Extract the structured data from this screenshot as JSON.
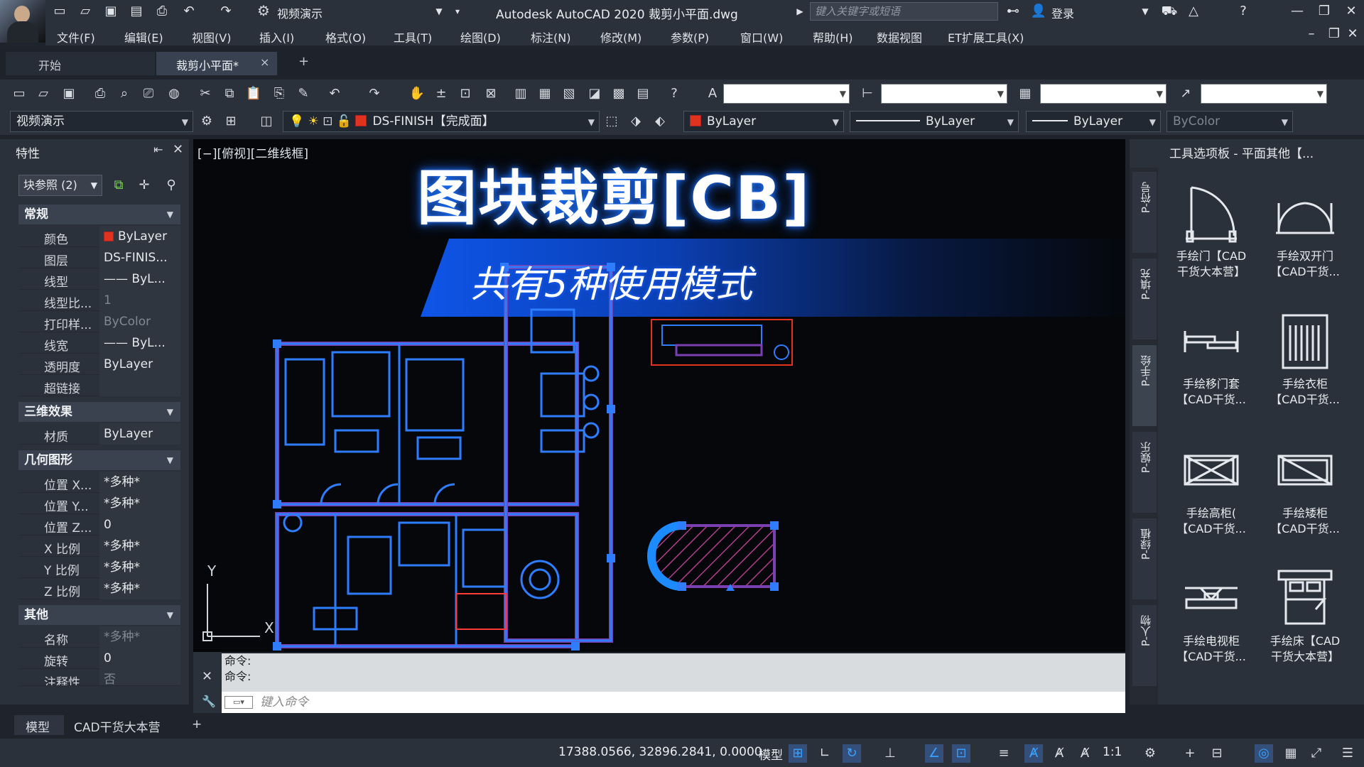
{
  "titlebar": {
    "workspace": "视频演示",
    "title": "Autodesk AutoCAD 2020    裁剪小平面.dwg",
    "search_placeholder": "键入关键字或短语",
    "login": "登录"
  },
  "menu": [
    "文件(F)",
    "编辑(E)",
    "视图(V)",
    "插入(I)",
    "格式(O)",
    "工具(T)",
    "绘图(D)",
    "标注(N)",
    "修改(M)",
    "参数(P)",
    "窗口(W)",
    "帮助(H)",
    "数据视图",
    "ET扩展工具(X)"
  ],
  "tabs": {
    "start": "开始",
    "file": "裁剪小平面*",
    "close": "×",
    "add": "+"
  },
  "toolbar2": {
    "workspace_combo": "视频演示",
    "layer_combo": "DS-FINISH【完成面】",
    "color_combo": "ByLayer",
    "linetype_combo": "ByLayer",
    "lineweight_combo": "ByLayer",
    "plotstyle_combo": "ByColor"
  },
  "properties": {
    "title": "特性",
    "selection": "块参照 (2)",
    "sections": {
      "general": "常规",
      "effects3d": "三维效果",
      "geometry": "几何图形",
      "misc": "其他"
    },
    "general": [
      {
        "k": "颜色",
        "v": "ByLayer"
      },
      {
        "k": "图层",
        "v": "DS-FINIS..."
      },
      {
        "k": "线型",
        "v": "—— ByL..."
      },
      {
        "k": "线型比...",
        "v": "1"
      },
      {
        "k": "打印样...",
        "v": "ByColor"
      },
      {
        "k": "线宽",
        "v": "—— ByL..."
      },
      {
        "k": "透明度",
        "v": "ByLayer"
      },
      {
        "k": "超链接",
        "v": ""
      }
    ],
    "effects3d": [
      {
        "k": "材质",
        "v": "ByLayer"
      }
    ],
    "geometry": [
      {
        "k": "位置 X...",
        "v": "*多种*"
      },
      {
        "k": "位置 Y...",
        "v": "*多种*"
      },
      {
        "k": "位置 Z...",
        "v": "0"
      },
      {
        "k": "X 比例",
        "v": "*多种*"
      },
      {
        "k": "Y 比例",
        "v": "*多种*"
      },
      {
        "k": "Z 比例",
        "v": "*多种*"
      }
    ],
    "misc": [
      {
        "k": "名称",
        "v": "*多种*"
      },
      {
        "k": "旋转",
        "v": "0"
      },
      {
        "k": "注释性",
        "v": "否"
      }
    ]
  },
  "viewport": {
    "label": "[−][俯视][二维线框]",
    "headline": "图块裁剪[CB]",
    "subline": "共有5种使用模式",
    "ucs_x": "X",
    "ucs_y": "Y"
  },
  "command": {
    "history": [
      "命令:",
      "命令:"
    ],
    "placeholder": "键入命令"
  },
  "palette": {
    "title": "工具选项板 - 平面其他【...",
    "vtabs": [
      "P-符号",
      "P-填充",
      "P-手绘",
      "P-娱乐",
      "P-绿植",
      "P-人物"
    ],
    "tools": [
      "手绘门【CAD\n干货大本营】",
      "手绘双开门\n【CAD干货...",
      "手绘移门套\n【CAD干货...",
      "手绘衣柜\n【CAD干货...",
      "手绘高柜(\n【CAD干货...",
      "手绘矮柜\n【CAD干货...",
      "手绘电视柜\n【CAD干货...",
      "手绘床【CAD\n干货大本营】"
    ]
  },
  "layout_tabs": [
    "模型",
    "CAD干货大本营",
    "+"
  ],
  "status": {
    "coords": "17388.0566, 32896.2841, 0.0000",
    "model": "模型",
    "scale": "1:1"
  },
  "colors": {
    "accent": "#1b72ff",
    "plan_line": "#2f7dff",
    "plan_wall": "#7a3fb0",
    "red": "#e0321c"
  }
}
